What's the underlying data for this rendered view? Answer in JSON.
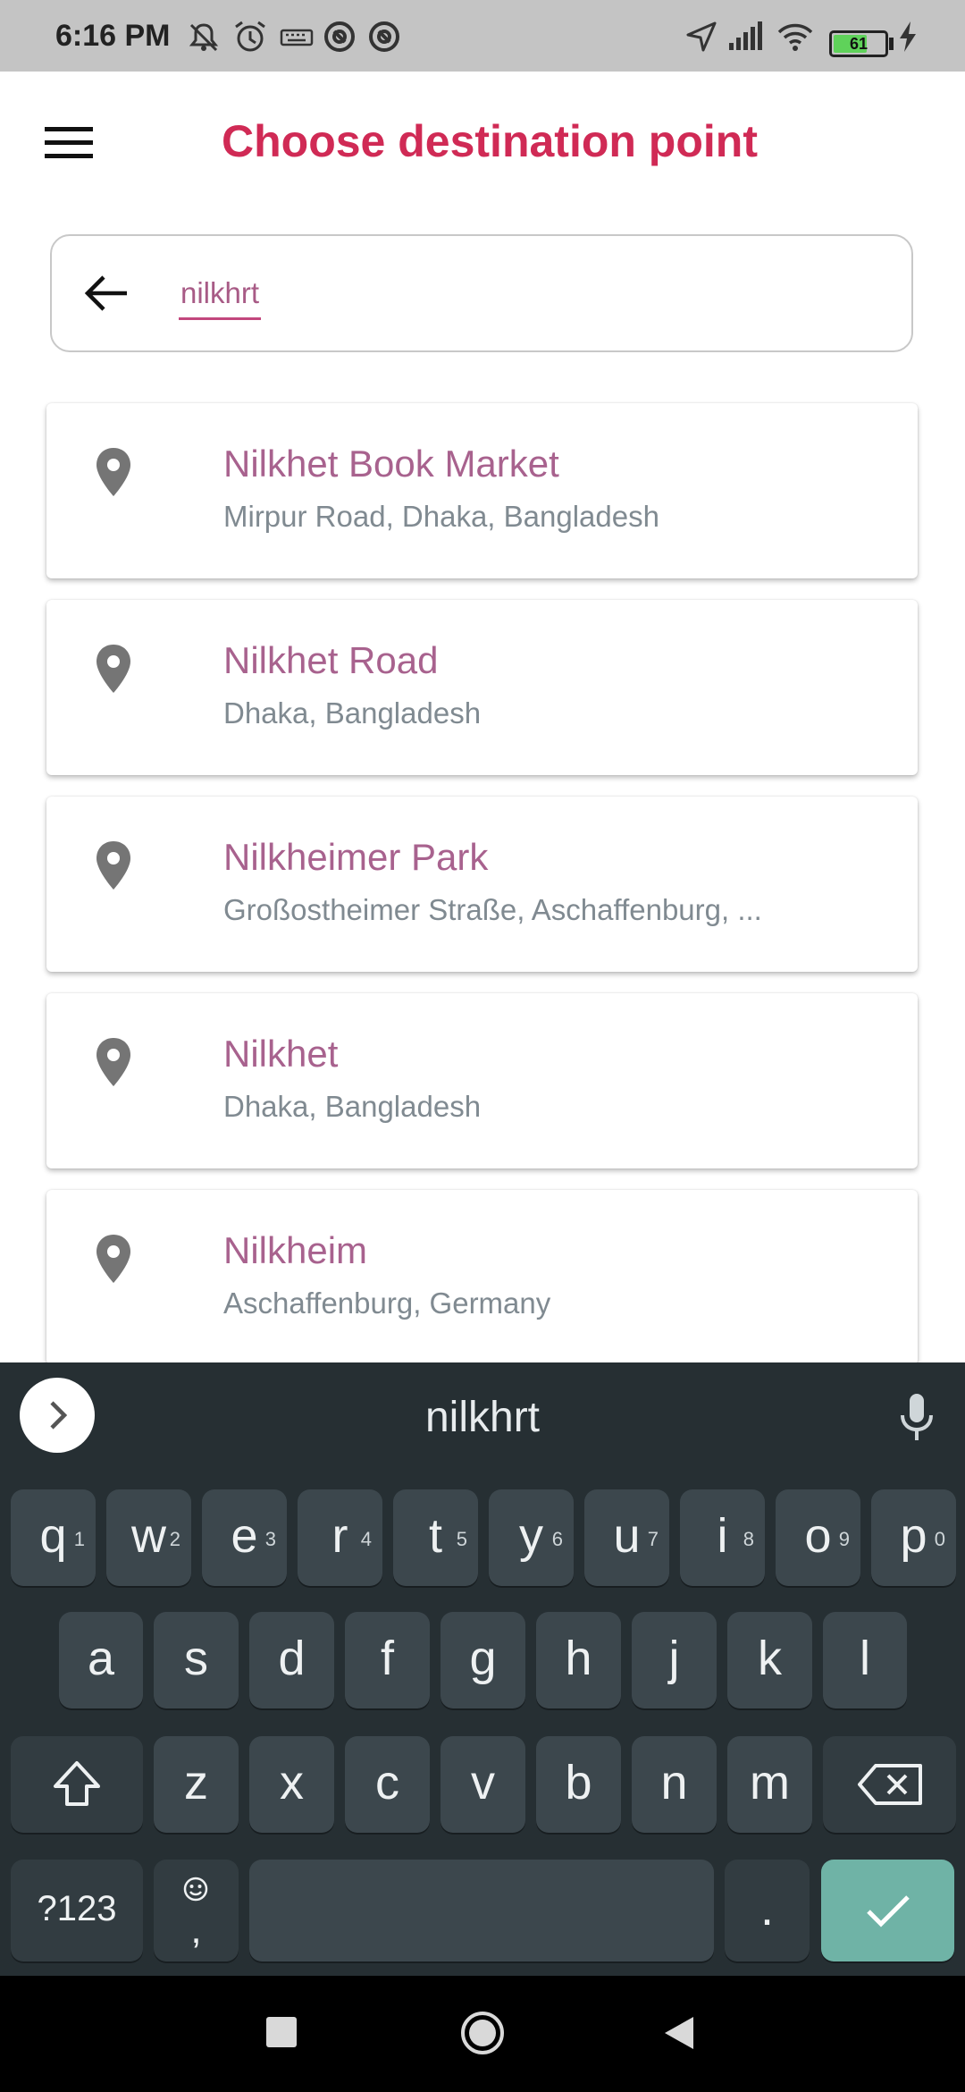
{
  "status_bar": {
    "time": "6:16 PM",
    "battery": "61",
    "icons": [
      "mute-icon",
      "alarm-icon",
      "keyboard-icon",
      "app-icon",
      "app-icon",
      "location-icon",
      "signal-icon",
      "wifi-icon",
      "battery-icon",
      "charging-icon"
    ]
  },
  "header": {
    "title": "Choose destination point",
    "menu_icon": "menu-icon"
  },
  "search": {
    "value": "nilkhrt",
    "back_icon": "arrow-left-icon"
  },
  "results": [
    {
      "title": "Nilkhet Book Market",
      "subtitle": "Mirpur Road, Dhaka, Bangladesh"
    },
    {
      "title": "Nilkhet Road",
      "subtitle": "Dhaka, Bangladesh"
    },
    {
      "title": "Nilkheimer Park",
      "subtitle": "Großostheimer Straße, Aschaffenburg, ..."
    },
    {
      "title": "Nilkhet",
      "subtitle": "Dhaka, Bangladesh"
    },
    {
      "title": "Nilkheim",
      "subtitle": "Aschaffenburg, Germany"
    }
  ],
  "keyboard": {
    "suggestion": "nilkhrt",
    "row1": [
      {
        "key": "q",
        "hint": "1"
      },
      {
        "key": "w",
        "hint": "2"
      },
      {
        "key": "e",
        "hint": "3"
      },
      {
        "key": "r",
        "hint": "4"
      },
      {
        "key": "t",
        "hint": "5"
      },
      {
        "key": "y",
        "hint": "6"
      },
      {
        "key": "u",
        "hint": "7"
      },
      {
        "key": "i",
        "hint": "8"
      },
      {
        "key": "o",
        "hint": "9"
      },
      {
        "key": "p",
        "hint": "0"
      }
    ],
    "row2": [
      "a",
      "s",
      "d",
      "f",
      "g",
      "h",
      "j",
      "k",
      "l"
    ],
    "row3": [
      "z",
      "x",
      "c",
      "v",
      "b",
      "n",
      "m"
    ],
    "symbols_label": "?123",
    "comma_label": ",",
    "period_label": "."
  },
  "colors": {
    "accent": "#d02a55",
    "result_title": "#a8628e",
    "keyboard_bg": "#262f33",
    "enter_key": "#6fb3a6"
  }
}
